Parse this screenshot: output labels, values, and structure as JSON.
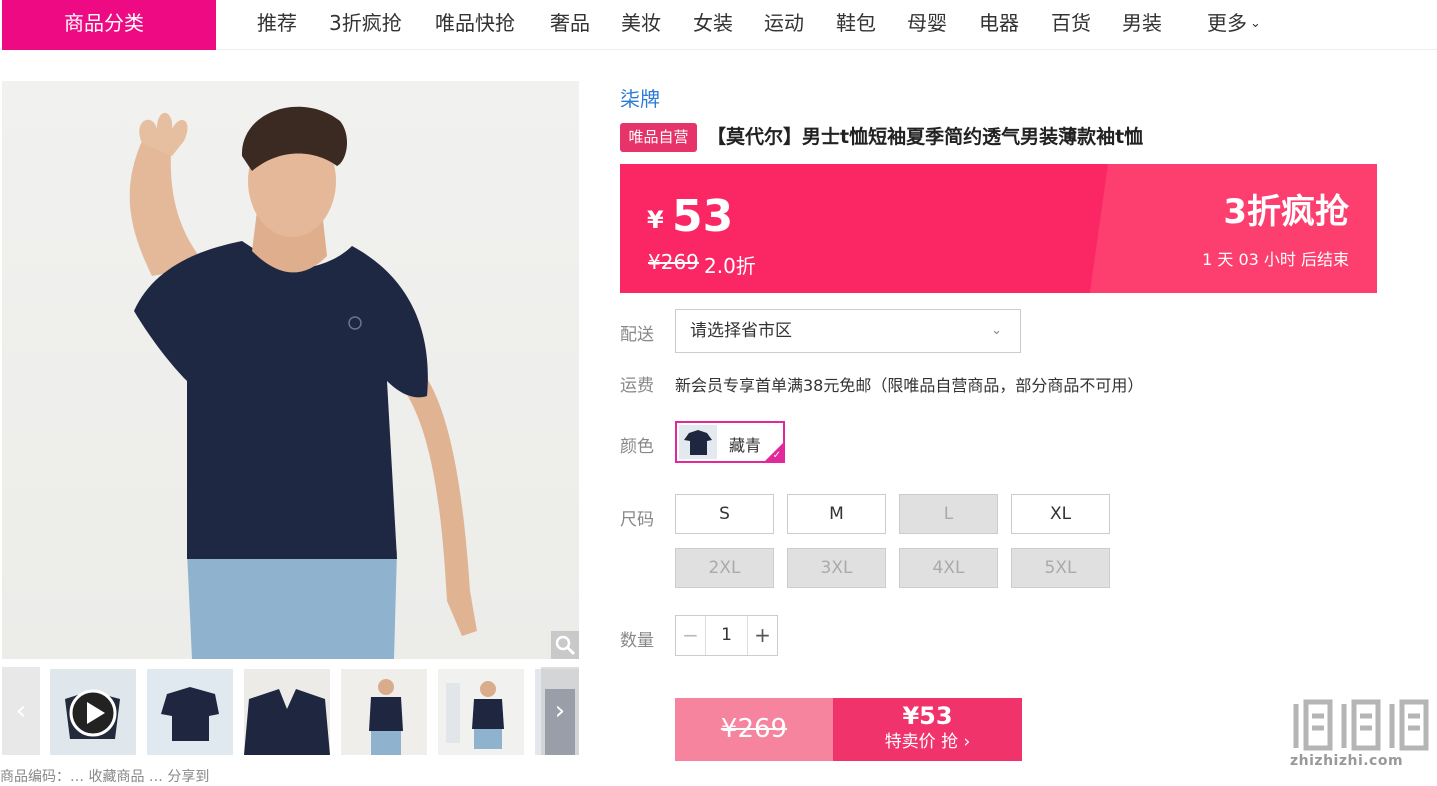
{
  "nav": {
    "category_label": "商品分类",
    "items": [
      "推荐",
      "3折疯抢",
      "唯品快抢",
      "奢品",
      "美妆",
      "女装",
      "运动",
      "鞋包",
      "母婴",
      "电器",
      "百货",
      "男装"
    ],
    "more_label": "更多"
  },
  "gallery": {
    "prev_arrow": "‹",
    "next_arrow": "›",
    "bottom_text": "商品编码：… 收藏商品 … 分享到"
  },
  "product": {
    "brand": "柒牌",
    "self_tag": "唯品自营",
    "title": "【莫代尔】男士t恤短袖夏季简约透气男装薄款袖t恤"
  },
  "price": {
    "currency": "¥",
    "now": "53",
    "original": "¥269",
    "discount": "2.0折",
    "promo": "3折疯抢",
    "countdown": "1  天  03  小时  后结束"
  },
  "delivery": {
    "label": "配送",
    "placeholder": "请选择省市区"
  },
  "shipping": {
    "label": "运费",
    "text": "新会员专享首单满38元免邮（限唯品自营商品，部分商品不可用）"
  },
  "color": {
    "label": "颜色",
    "option": "藏青"
  },
  "size": {
    "label": "尺码",
    "options": [
      {
        "name": "S",
        "available": true
      },
      {
        "name": "M",
        "available": true
      },
      {
        "name": "L",
        "available": false
      },
      {
        "name": "XL",
        "available": true
      },
      {
        "name": "2XL",
        "available": false
      },
      {
        "name": "3XL",
        "available": false
      },
      {
        "name": "4XL",
        "available": false
      },
      {
        "name": "5XL",
        "available": false
      }
    ]
  },
  "quantity": {
    "label": "数量",
    "value": "1",
    "minus": "−",
    "plus": "+"
  },
  "buy": {
    "original": "¥269",
    "price": "¥53",
    "action": "特卖价 抢 ›"
  },
  "watermark": {
    "text": "zhizhizhi.com"
  },
  "colors": {
    "brand_pink": "#ee0a82",
    "price_red": "#fb2764",
    "link_blue": "#2d7cd6"
  }
}
